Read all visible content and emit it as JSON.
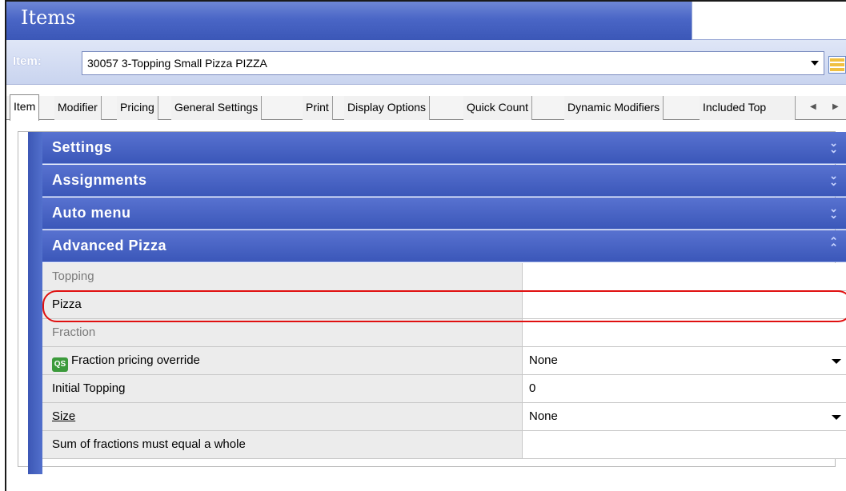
{
  "window": {
    "title": "Items"
  },
  "item_selector": {
    "label": "Item:",
    "value": "30057 3-Topping Small Pizza PIZZA"
  },
  "tabs": [
    {
      "label": "Item",
      "active": true
    },
    {
      "label": "Modifier"
    },
    {
      "label": "Pricing"
    },
    {
      "label": "General Settings"
    },
    {
      "label": "Print"
    },
    {
      "label": "Display Options"
    },
    {
      "label": "Quick Count"
    },
    {
      "label": "Dynamic Modifiers"
    },
    {
      "label": "Included Top"
    }
  ],
  "sections": {
    "settings": {
      "label": "Settings",
      "expanded": false
    },
    "assignments": {
      "label": "Assignments",
      "expanded": false
    },
    "auto_menu": {
      "label": "Auto menu",
      "expanded": false
    },
    "advanced_pizza": {
      "label": "Advanced Pizza",
      "expanded": true
    }
  },
  "advanced_pizza_rows": {
    "topping": {
      "label": "Topping",
      "checked": false
    },
    "pizza": {
      "label": "Pizza",
      "checked": true
    },
    "fraction": {
      "label": "Fraction",
      "checked": false
    },
    "fraction_pricing_override": {
      "label": "Fraction pricing override",
      "icon": "qs-icon",
      "icon_text": "QS",
      "value": "None"
    },
    "initial_topping": {
      "label": "Initial Topping",
      "value": "0"
    },
    "size": {
      "label": "Size",
      "value": "None"
    },
    "sum_of_fractions": {
      "label": "Sum of fractions must equal a whole",
      "checked": false
    }
  },
  "colors": {
    "header_blue": "#3b57b9",
    "highlight_red": "#e01010"
  }
}
